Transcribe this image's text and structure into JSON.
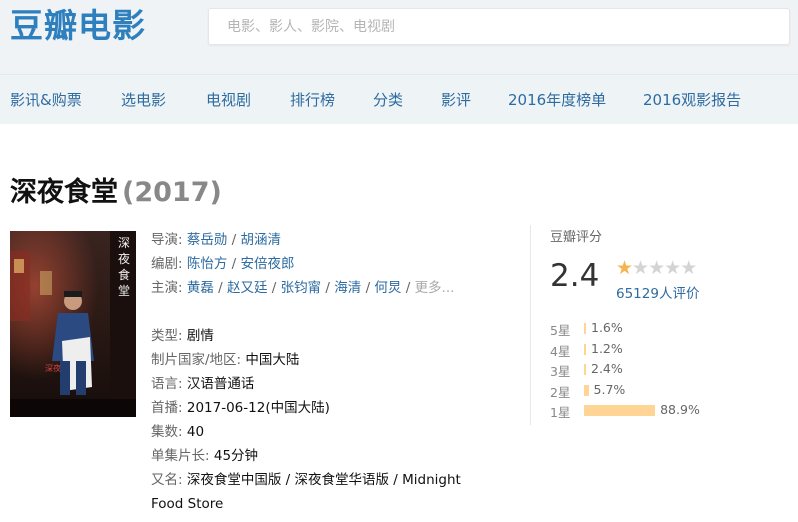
{
  "site": {
    "logo": "豆瓣电影"
  },
  "search": {
    "placeholder": "电影、影人、影院、电视剧"
  },
  "nav": [
    "影讯&购票",
    "选电影",
    "电视剧",
    "排行榜",
    "分类",
    "影评",
    "2016年度榜单",
    "2016观影报告"
  ],
  "movie": {
    "title": "深夜食堂",
    "year": "(2017)",
    "directors_label": "导演:",
    "directors": [
      "蔡岳勋",
      "胡涵清"
    ],
    "writers_label": "编剧:",
    "writers": [
      "陈怡方",
      "安倍夜郎"
    ],
    "cast_label": "主演:",
    "cast": [
      "黄磊",
      "赵又廷",
      "张钧甯",
      "海清",
      "何炅"
    ],
    "cast_more": "更多...",
    "genre_label": "类型:",
    "genre": "剧情",
    "country_label": "制片国家/地区:",
    "country": "中国大陆",
    "language_label": "语言:",
    "language": "汉语普通话",
    "premiere_label": "首播:",
    "premiere": "2017-06-12(中国大陆)",
    "episodes_label": "集数:",
    "episodes": "40",
    "runtime_label": "单集片长:",
    "runtime": "45分钟",
    "aka_label": "又名:",
    "aka": "深夜食堂中国版 / 深夜食堂华语版 / Midnight Food Store"
  },
  "rating": {
    "label": "豆瓣评分",
    "score": "2.4",
    "stars_filled": 1,
    "stars_total": 5,
    "votes_text": "65129人评价",
    "accent_color": "#f4b54f",
    "bar_color": "#ffd596",
    "distribution": [
      {
        "label": "5星",
        "percent_text": "1.6%",
        "percent": 1.6
      },
      {
        "label": "4星",
        "percent_text": "1.2%",
        "percent": 1.2
      },
      {
        "label": "3星",
        "percent_text": "2.4%",
        "percent": 2.4
      },
      {
        "label": "2星",
        "percent_text": "5.7%",
        "percent": 5.7
      },
      {
        "label": "1星",
        "percent_text": "88.9%",
        "percent": 88.9
      }
    ]
  },
  "colors": {
    "link": "#2e6ba0",
    "logo": "#2e7fbe",
    "nav_bg": "#eef3f6"
  }
}
